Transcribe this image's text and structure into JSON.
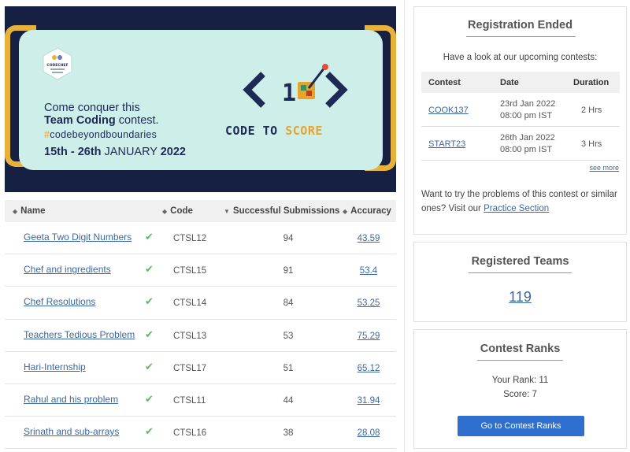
{
  "banner": {
    "badge_text": "CODECHEF",
    "line1": "Come conquer this",
    "line2_bold": "Team Coding",
    "line2_rest": " contest.",
    "hashtag_symbol": "#",
    "hashtag_text": "codebeyondboundaries",
    "date_prefix": "15th - 26th ",
    "date_month": "JANUARY ",
    "date_year": "2022",
    "mark_text": "1",
    "cts_a": "CODE TO ",
    "cts_b": "SCORE"
  },
  "table": {
    "headers": {
      "name": "Name",
      "code": "Code",
      "subs": "Successful Submissions",
      "acc": "Accuracy"
    },
    "rows": [
      {
        "name": "Geeta Two Digit Numbers",
        "code": "CTSL12",
        "subs": "94",
        "acc": "43.59"
      },
      {
        "name": "Chef and ingredients",
        "code": "CTSL15",
        "subs": "91",
        "acc": "53.4"
      },
      {
        "name": "Chef Resolutions",
        "code": "CTSL14",
        "subs": "84",
        "acc": "53.25"
      },
      {
        "name": "Teachers Tedious Problem",
        "code": "CTSL13",
        "subs": "53",
        "acc": "75.29"
      },
      {
        "name": "Hari-Internship",
        "code": "CTSL17",
        "subs": "51",
        "acc": "65.12"
      },
      {
        "name": "Rahul and his problem",
        "code": "CTSL11",
        "subs": "44",
        "acc": "31.94"
      },
      {
        "name": "Srinath and sub-arrays",
        "code": "CTSL16",
        "subs": "38",
        "acc": "28.08"
      }
    ]
  },
  "registration": {
    "title": "Registration Ended",
    "subtitle": "Have a look at our upcoming contests:",
    "headers": {
      "contest": "Contest",
      "date": "Date",
      "duration": "Duration"
    },
    "contests": [
      {
        "code": "COOK137",
        "date1": "23rd Jan 2022",
        "date2": "08:00 pm IST",
        "duration": "2 Hrs"
      },
      {
        "code": "START23",
        "date1": "26th Jan 2022",
        "date2": "08:00 pm IST",
        "duration": "3 Hrs"
      }
    ],
    "see_more": "see more",
    "note_text": "Want to try the problems of this contest or similar ones? Visit our ",
    "note_link": "Practice Section"
  },
  "teams": {
    "title": "Registered Teams",
    "count": "119"
  },
  "ranks": {
    "title": "Contest Ranks",
    "rank_text": "Your Rank: 11",
    "score_text": "Score: 7",
    "button": "Go to Contest Ranks"
  },
  "colors": {
    "accent": "#2f6fd0",
    "link": "#3b68a3",
    "banner_bg": "#152042",
    "banner_card": "#cdeee9",
    "gold": "#e8b13a",
    "check": "#5cb85c"
  },
  "icons": {
    "check": "check-icon",
    "sort": "sort-icon"
  }
}
